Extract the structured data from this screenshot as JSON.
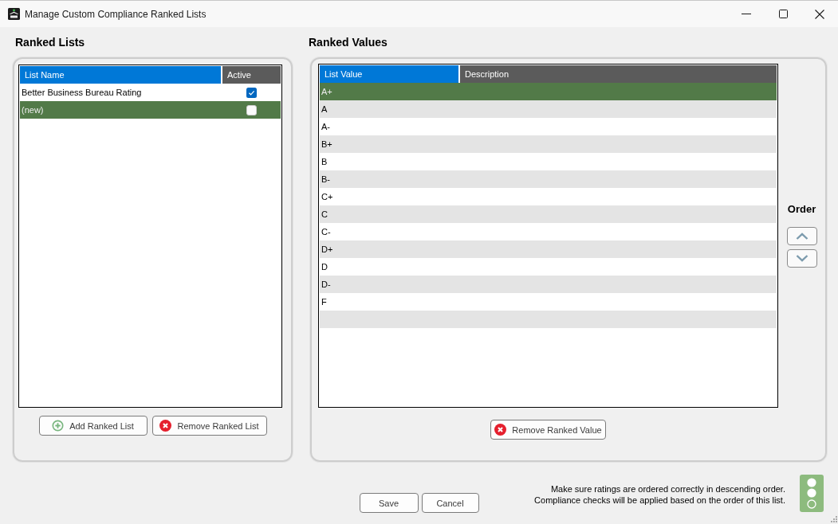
{
  "window": {
    "title": "Manage Custom Compliance Ranked Lists"
  },
  "ranked_lists": {
    "heading": "Ranked Lists",
    "columns": [
      {
        "label": "List Name",
        "selected": true
      },
      {
        "label": "Active",
        "selected": false
      }
    ],
    "rows": [
      {
        "name": "Better Business Bureau Rating",
        "active": true,
        "selected": false
      },
      {
        "name": "(new)",
        "active": false,
        "selected": true
      }
    ],
    "buttons": [
      {
        "label": "Add Ranked List",
        "kind": "add"
      },
      {
        "label": "Remove Ranked List",
        "kind": "remove"
      }
    ]
  },
  "ranked_values": {
    "heading": "Ranked Values",
    "columns": [
      {
        "label": "List Value",
        "selected": true
      },
      {
        "label": "Description",
        "selected": false
      }
    ],
    "rows": [
      {
        "value": "A+",
        "selected": true
      },
      {
        "value": "A",
        "selected": false
      },
      {
        "value": "A-",
        "selected": false
      },
      {
        "value": "B+",
        "selected": false
      },
      {
        "value": "B",
        "selected": false
      },
      {
        "value": "B-",
        "selected": false
      },
      {
        "value": "C+",
        "selected": false
      },
      {
        "value": "C",
        "selected": false
      },
      {
        "value": "C-",
        "selected": false
      },
      {
        "value": "D+",
        "selected": false
      },
      {
        "value": "D",
        "selected": false
      },
      {
        "value": "D-",
        "selected": false
      },
      {
        "value": "F",
        "selected": false
      }
    ],
    "order_label": "Order",
    "buttons": [
      {
        "label": "Remove Ranked Value",
        "kind": "remove"
      }
    ]
  },
  "footer": {
    "buttons": [
      {
        "label": "Save"
      },
      {
        "label": "Cancel"
      }
    ],
    "note": [
      "Make sure ratings are ordered correctly in descending order.",
      "Compliance checks will be applied based on the order of this list."
    ]
  }
}
